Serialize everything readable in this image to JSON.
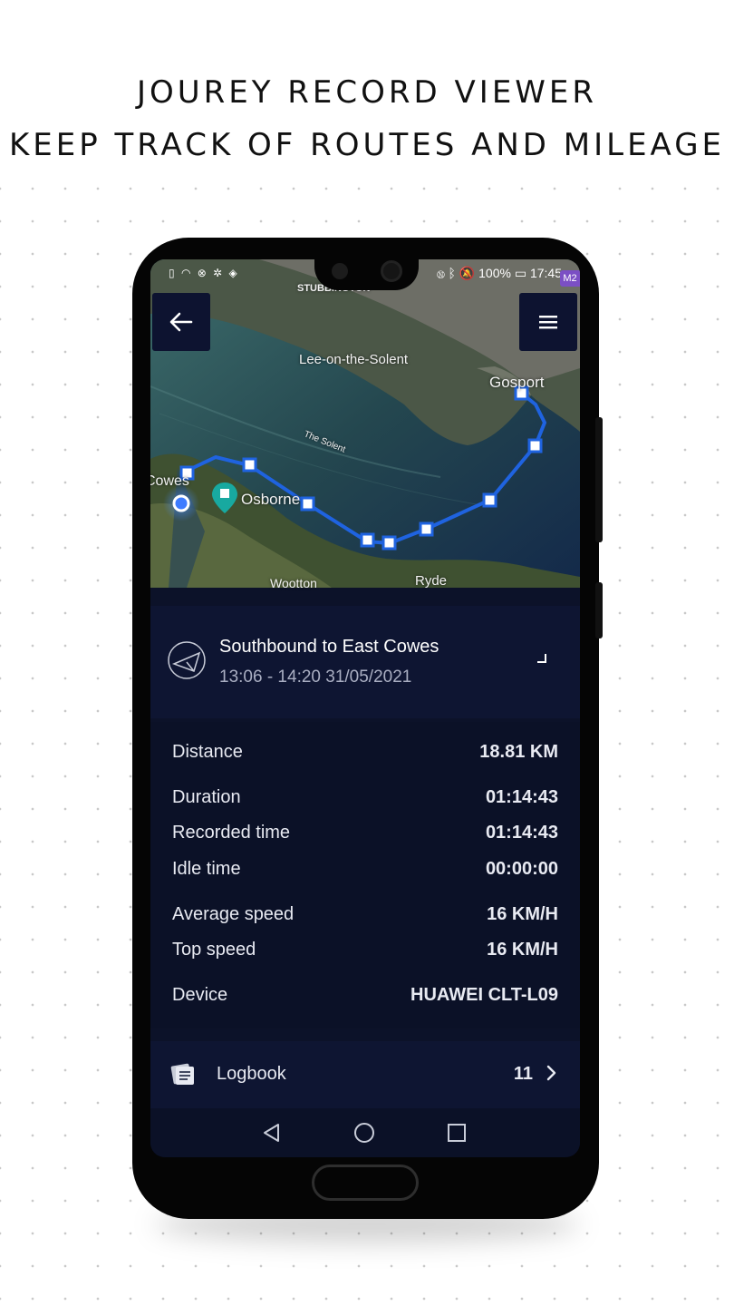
{
  "headline": {
    "line1": "JOUREY RECORD VIEWER",
    "line2": "KEEP TRACK OF ROUTES AND MILEAGE"
  },
  "status_bar": {
    "battery": "100%",
    "time": "17:45",
    "badge": "M2"
  },
  "map": {
    "labels": {
      "stubbington": "STUBBINGTON",
      "lee": "Lee-on-the-Solent",
      "gosport": "Gosport",
      "solent": "The Solent",
      "cowes": "Cowes",
      "osborne": "Osborne",
      "wootton": "Wootton",
      "ryde": "Ryde"
    },
    "route_color": "#1f63e0"
  },
  "journey": {
    "title": "Southbound to East Cowes",
    "time": "13:06 - 14:20 31/05/2021"
  },
  "stats": {
    "distance": {
      "label": "Distance",
      "value": "18.81 KM"
    },
    "duration": {
      "label": "Duration",
      "value": "01:14:43"
    },
    "recorded_time": {
      "label": "Recorded time",
      "value": "01:14:43"
    },
    "idle_time": {
      "label": "Idle time",
      "value": "00:00:00"
    },
    "average_speed": {
      "label": "Average speed",
      "value": "16 KM/H"
    },
    "top_speed": {
      "label": "Top speed",
      "value": "16 KM/H"
    },
    "device": {
      "label": "Device",
      "value": "HUAWEI CLT-L09"
    }
  },
  "logbook": {
    "label": "Logbook",
    "count": "11"
  },
  "icons": {
    "back": "arrow-left-icon",
    "menu": "hamburger-menu-icon",
    "journey": "sail-icon",
    "expand": "expand-corner-icon",
    "logbook": "notebook-icon",
    "chevron": "chevron-right-icon",
    "nav_back": "triangle-back-icon",
    "nav_home": "circle-home-icon",
    "nav_recent": "square-recent-icon"
  }
}
